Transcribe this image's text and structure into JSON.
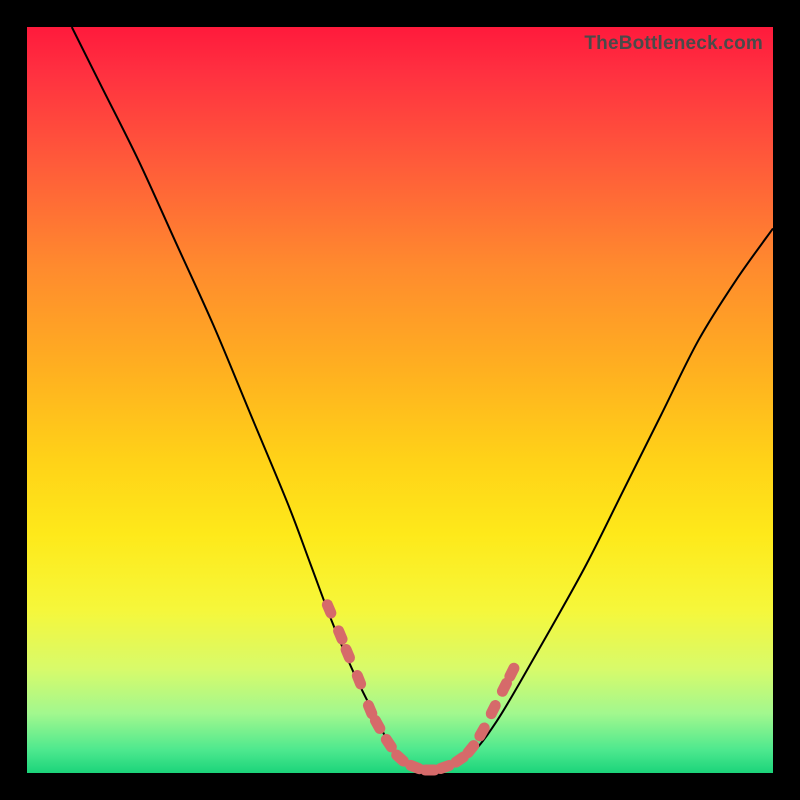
{
  "watermark": "TheBottleneck.com",
  "chart_data": {
    "type": "line",
    "title": "",
    "xlabel": "",
    "ylabel": "",
    "xlim": [
      0,
      100
    ],
    "ylim": [
      0,
      100
    ],
    "grid": false,
    "legend": false,
    "background_gradient": [
      "#ff1a3c",
      "#1bd47a"
    ],
    "series": [
      {
        "name": "bottleneck-curve",
        "x": [
          6,
          10,
          15,
          20,
          25,
          30,
          35,
          38,
          41,
          44,
          47,
          49,
          51,
          53,
          55,
          57,
          60,
          63,
          66,
          70,
          75,
          80,
          85,
          90,
          95,
          100
        ],
        "y": [
          100,
          92,
          82,
          71,
          60,
          48,
          36,
          28,
          20,
          13,
          7,
          3,
          1,
          0,
          0,
          1,
          3,
          7,
          12,
          19,
          28,
          38,
          48,
          58,
          66,
          73
        ]
      }
    ],
    "markers": {
      "name": "highlight-points",
      "x": [
        40.5,
        42.0,
        43.0,
        44.5,
        46.0,
        47.0,
        48.5,
        50.0,
        52.0,
        54.0,
        56.0,
        58.0,
        59.5,
        61.0,
        62.5,
        64.0,
        65.0
      ],
      "y": [
        22.0,
        18.5,
        16.0,
        12.5,
        8.5,
        6.5,
        4.0,
        2.0,
        0.8,
        0.4,
        0.8,
        1.8,
        3.2,
        5.5,
        8.5,
        11.5,
        13.5
      ]
    }
  }
}
